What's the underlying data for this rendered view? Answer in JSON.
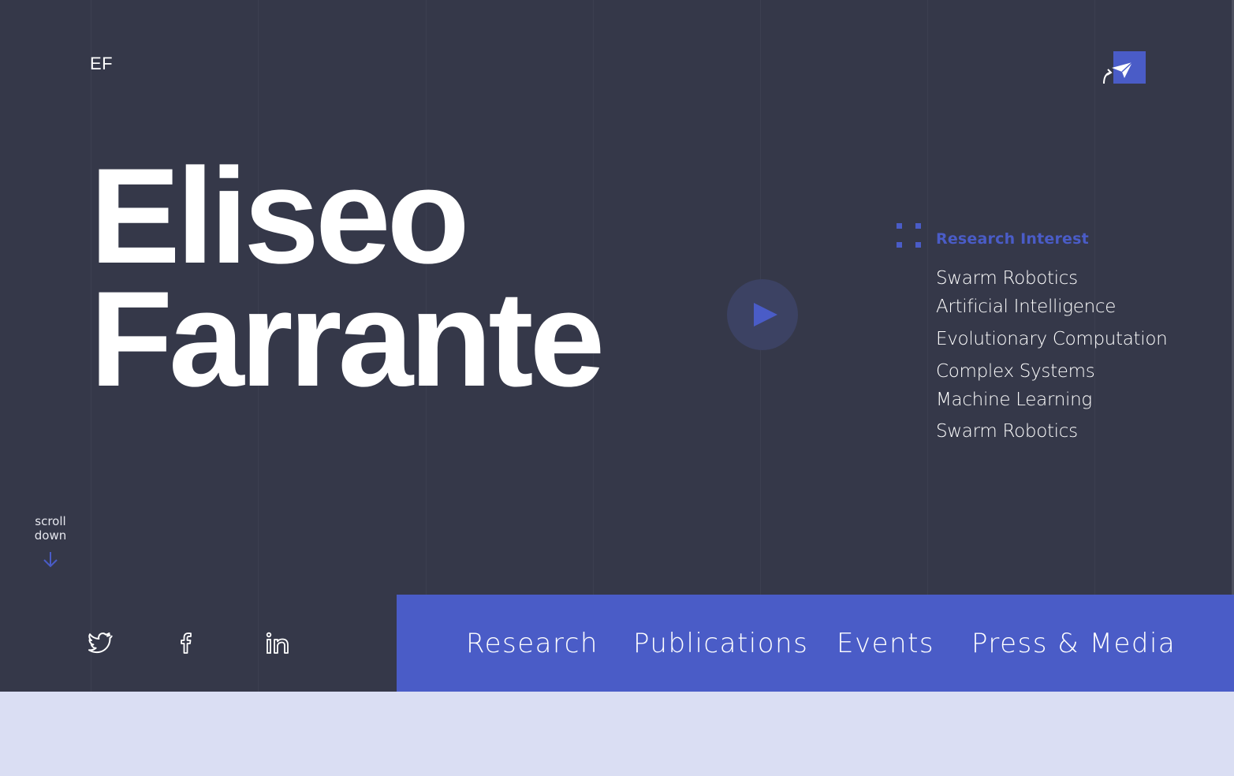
{
  "header": {
    "logo": "EF"
  },
  "hero": {
    "first_name": "Eliseo",
    "last_name": "Farrante"
  },
  "research": {
    "title": "Research Interest",
    "items": [
      "Swarm Robotics",
      "Artificial Intelligence",
      "Evolutionary Computation",
      "Complex Systems",
      "Machine Learning",
      "Swarm Robotics"
    ]
  },
  "scroll": {
    "label": "scroll down"
  },
  "social": [
    {
      "icon": "twitter-icon"
    },
    {
      "icon": "facebook-icon"
    },
    {
      "icon": "linkedin-icon"
    }
  ],
  "nav": {
    "items": [
      "Research",
      "Publications",
      "Events",
      "Press & Media"
    ]
  },
  "colors": {
    "background": "#353849",
    "accent": "#4a5cc7",
    "lower": "#dadef3",
    "text": "#ffffff"
  }
}
